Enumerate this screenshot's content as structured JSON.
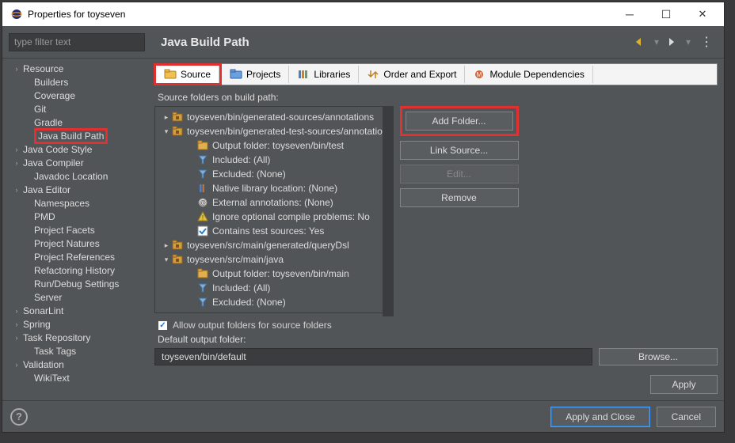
{
  "window": {
    "title": "Properties for toyseven",
    "filter_placeholder": "type filter text"
  },
  "page_title": "Java Build Path",
  "sidebar": {
    "items": [
      {
        "label": "Resource",
        "expandable": true
      },
      {
        "label": "Builders",
        "expandable": false
      },
      {
        "label": "Coverage",
        "expandable": false
      },
      {
        "label": "Git",
        "expandable": false
      },
      {
        "label": "Gradle",
        "expandable": false
      },
      {
        "label": "Java Build Path",
        "expandable": false,
        "selected": true
      },
      {
        "label": "Java Code Style",
        "expandable": true
      },
      {
        "label": "Java Compiler",
        "expandable": true
      },
      {
        "label": "Javadoc Location",
        "expandable": false
      },
      {
        "label": "Java Editor",
        "expandable": true
      },
      {
        "label": "Namespaces",
        "expandable": false
      },
      {
        "label": "PMD",
        "expandable": false
      },
      {
        "label": "Project Facets",
        "expandable": false
      },
      {
        "label": "Project Natures",
        "expandable": false
      },
      {
        "label": "Project References",
        "expandable": false
      },
      {
        "label": "Refactoring History",
        "expandable": false
      },
      {
        "label": "Run/Debug Settings",
        "expandable": false
      },
      {
        "label": "Server",
        "expandable": false
      },
      {
        "label": "SonarLint",
        "expandable": true
      },
      {
        "label": "Spring",
        "expandable": true
      },
      {
        "label": "Task Repository",
        "expandable": true
      },
      {
        "label": "Task Tags",
        "expandable": false
      },
      {
        "label": "Validation",
        "expandable": true
      },
      {
        "label": "WikiText",
        "expandable": false
      }
    ]
  },
  "tabs": [
    {
      "icon": "source-folder-icon",
      "label": "Source",
      "active": true
    },
    {
      "icon": "projects-icon",
      "label": "Projects",
      "active": false
    },
    {
      "icon": "libraries-icon",
      "label": "Libraries",
      "active": false
    },
    {
      "icon": "order-icon",
      "label": "Order and Export",
      "active": false
    },
    {
      "icon": "module-icon",
      "label": "Module Dependencies",
      "active": false
    }
  ],
  "source_section": {
    "header": "Source folders on build path:",
    "rows": [
      {
        "indent": 0,
        "chev": "▸",
        "icon": "pkg",
        "text": "toyseven/bin/generated-sources/annotations"
      },
      {
        "indent": 0,
        "chev": "▾",
        "icon": "pkg",
        "text": "toyseven/bin/generated-test-sources/annotations"
      },
      {
        "indent": 1,
        "chev": "",
        "icon": "folder",
        "text": "Output folder: toyseven/bin/test"
      },
      {
        "indent": 1,
        "chev": "",
        "icon": "filter",
        "text": "Included: (All)"
      },
      {
        "indent": 1,
        "chev": "",
        "icon": "filter",
        "text": "Excluded: (None)"
      },
      {
        "indent": 1,
        "chev": "",
        "icon": "lib",
        "text": "Native library location: (None)"
      },
      {
        "indent": 1,
        "chev": "",
        "icon": "annot",
        "text": "External annotations: (None)"
      },
      {
        "indent": 1,
        "chev": "",
        "icon": "warn",
        "text": "Ignore optional compile problems: No"
      },
      {
        "indent": 1,
        "chev": "",
        "icon": "check",
        "text": "Contains test sources: Yes"
      },
      {
        "indent": 0,
        "chev": "▸",
        "icon": "pkg",
        "text": "toyseven/src/main/generated/queryDsl"
      },
      {
        "indent": 0,
        "chev": "▾",
        "icon": "pkg",
        "text": "toyseven/src/main/java"
      },
      {
        "indent": 1,
        "chev": "",
        "icon": "folder",
        "text": "Output folder: toyseven/bin/main"
      },
      {
        "indent": 1,
        "chev": "",
        "icon": "filter",
        "text": "Included: (All)"
      },
      {
        "indent": 1,
        "chev": "",
        "icon": "filter",
        "text": "Excluded: (None)"
      }
    ],
    "allow_output_label": "Allow output folders for source folders",
    "allow_output_checked": true,
    "default_output_label": "Default output folder:",
    "default_output_value": "toyseven/bin/default"
  },
  "buttons": {
    "add_folder": "Add Folder...",
    "link_source": "Link Source...",
    "edit": "Edit...",
    "remove": "Remove",
    "browse": "Browse...",
    "apply": "Apply",
    "apply_close": "Apply and Close",
    "cancel": "Cancel"
  }
}
